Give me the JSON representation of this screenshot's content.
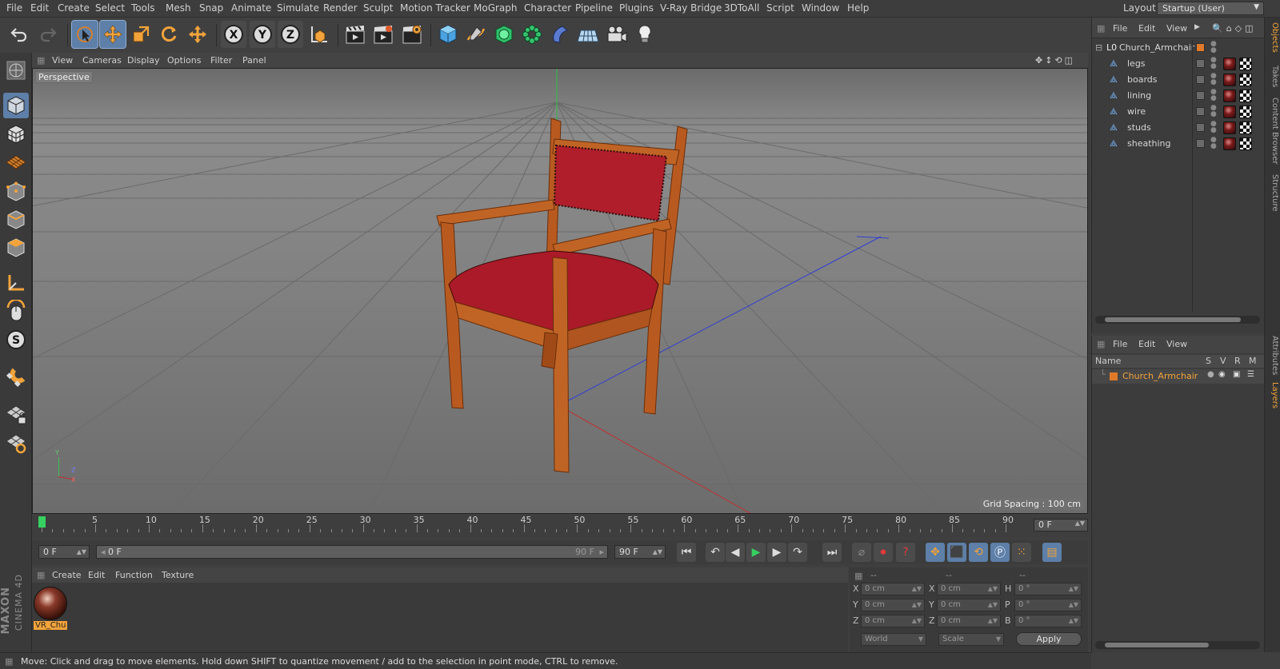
{
  "menubar": {
    "items": [
      "File",
      "Edit",
      "Create",
      "Select",
      "Tools",
      "Mesh",
      "Snap",
      "Animate",
      "Simulate",
      "Render",
      "Sculpt",
      "Motion Tracker",
      "MoGraph",
      "Character",
      "Pipeline",
      "Plugins",
      "V-Ray Bridge",
      "3DToAll",
      "Script",
      "Window",
      "Help"
    ],
    "layout_label": "Layout:",
    "layout_value": "Startup (User)"
  },
  "viewport": {
    "menu": [
      "View",
      "Cameras",
      "Display",
      "Options",
      "Filter",
      "Panel"
    ],
    "label": "Perspective",
    "grid_spacing": "Grid Spacing : 100 cm",
    "axis_y": "Y",
    "axis_z": "Z",
    "axis_x": "X"
  },
  "timeline": {
    "ticks": [
      "0",
      "5",
      "10",
      "15",
      "20",
      "25",
      "30",
      "35",
      "40",
      "45",
      "50",
      "55",
      "60",
      "65",
      "70",
      "75",
      "80",
      "85",
      "90"
    ],
    "current_frame": "0 F"
  },
  "transport": {
    "start_frame": "0 F",
    "range_start": "0 F",
    "range_end": "90 F",
    "end_frame": "90 F"
  },
  "material": {
    "menu": [
      "Create",
      "Edit",
      "Function",
      "Texture"
    ],
    "name": "VR_Chu"
  },
  "coords": {
    "header": [
      "--",
      "--",
      "--"
    ],
    "rows": [
      {
        "l1": "X",
        "v1": "0 cm",
        "l2": "X",
        "v2": "0 cm",
        "l3": "H",
        "v3": "0 °"
      },
      {
        "l1": "Y",
        "v1": "0 cm",
        "l2": "Y",
        "v2": "0 cm",
        "l3": "P",
        "v3": "0 °"
      },
      {
        "l1": "Z",
        "v1": "0 cm",
        "l2": "Z",
        "v2": "0 cm",
        "l3": "B",
        "v3": "0 °"
      }
    ],
    "mode": "World",
    "scale": "Scale",
    "apply": "Apply"
  },
  "status": "Move: Click and drag to move elements. Hold down SHIFT to quantize movement / add to the selection in point mode, CTRL to remove.",
  "objects": {
    "menu": [
      "File",
      "Edit",
      "View"
    ],
    "root": "Church_Armchair",
    "children": [
      "legs",
      "boards",
      "lining",
      "wire",
      "studs",
      "sheathing"
    ]
  },
  "layers": {
    "menu": [
      "File",
      "Edit",
      "View"
    ],
    "columns": {
      "name": "Name",
      "s": "S",
      "v": "V",
      "r": "R",
      "m": "M"
    },
    "rows": [
      "Church_Armchair"
    ]
  },
  "right_tabs": [
    "Objects",
    "Takes",
    "Content Browser",
    "Structure",
    "Attributes",
    "Layers"
  ],
  "brand": {
    "maxon": "MAXON",
    "product": "CINEMA 4D"
  },
  "colors": {
    "accent": "#f2a33a",
    "selection": "#5d7fa8",
    "layer": "#e07a2a"
  }
}
